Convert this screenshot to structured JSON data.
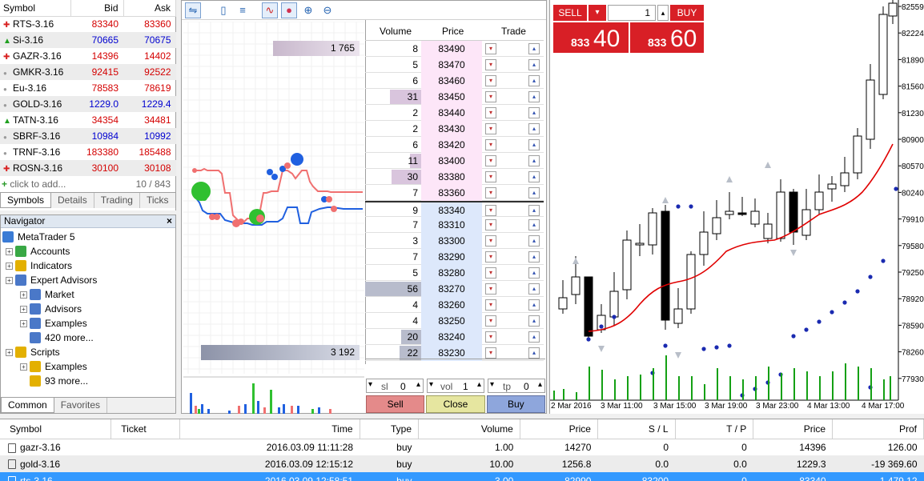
{
  "market_watch": {
    "headers": {
      "symbol": "Symbol",
      "bid": "Bid",
      "ask": "Ask"
    },
    "rows": [
      {
        "symbol": "RTS-3.16",
        "bid": "83340",
        "ask": "83360",
        "dir": "up"
      },
      {
        "symbol": "Si-3.16",
        "bid": "70665",
        "ask": "70675",
        "dir": "upg"
      },
      {
        "symbol": "GAZR-3.16",
        "bid": "14396",
        "ask": "14402",
        "dir": "up"
      },
      {
        "symbol": "GMKR-3.16",
        "bid": "92415",
        "ask": "92522",
        "dir": "none"
      },
      {
        "symbol": "Eu-3.16",
        "bid": "78583",
        "ask": "78619",
        "dir": "none"
      },
      {
        "symbol": "GOLD-3.16",
        "bid": "1229.0",
        "ask": "1229.4",
        "dir": "none"
      },
      {
        "symbol": "TATN-3.16",
        "bid": "34354",
        "ask": "34481",
        "dir": "upg"
      },
      {
        "symbol": "SBRF-3.16",
        "bid": "10984",
        "ask": "10992",
        "dir": "none"
      },
      {
        "symbol": "TRNF-3.16",
        "bid": "183380",
        "ask": "185488",
        "dir": "none"
      },
      {
        "symbol": "ROSN-3.16",
        "bid": "30100",
        "ask": "30108",
        "dir": "up"
      }
    ],
    "add_label": "click to add...",
    "count": "10 / 843",
    "tabs": [
      "Symbols",
      "Details",
      "Trading",
      "Ticks"
    ]
  },
  "navigator": {
    "title": "Navigator",
    "close": "×",
    "items": [
      {
        "label": "MetaTrader 5",
        "color": "#3a7bd5"
      },
      {
        "label": "Accounts",
        "color": "#39a845"
      },
      {
        "label": "Indicators",
        "color": "#e3b000"
      },
      {
        "label": "Expert Advisors",
        "color": "#4a78c8"
      },
      {
        "label": "Market",
        "color": "#4a78c8"
      },
      {
        "label": "Advisors",
        "color": "#4a78c8"
      },
      {
        "label": "Examples",
        "color": "#4a78c8"
      },
      {
        "label": "420 more...",
        "color": "#4a78c8"
      },
      {
        "label": "Scripts",
        "color": "#e3b000"
      },
      {
        "label": "Examples",
        "color": "#e3b000"
      },
      {
        "label": "93 more...",
        "color": "#e3b000"
      }
    ],
    "tabs": [
      "Common",
      "Favorites"
    ]
  },
  "dom": {
    "headers": {
      "volume": "Volume",
      "price": "Price",
      "trade": "Trade"
    },
    "ask_bar": "1 765",
    "bid_bar": "3 192",
    "rows": [
      {
        "volume": "8",
        "price": "83490",
        "side": "ask",
        "fill": 0
      },
      {
        "volume": "5",
        "price": "83470",
        "side": "ask",
        "fill": 0
      },
      {
        "volume": "6",
        "price": "83460",
        "side": "ask",
        "fill": 0
      },
      {
        "volume": "31",
        "price": "83450",
        "side": "ask",
        "fill": 0.55
      },
      {
        "volume": "2",
        "price": "83440",
        "side": "ask",
        "fill": 0
      },
      {
        "volume": "2",
        "price": "83430",
        "side": "ask",
        "fill": 0
      },
      {
        "volume": "6",
        "price": "83420",
        "side": "ask",
        "fill": 0
      },
      {
        "volume": "11",
        "price": "83400",
        "side": "ask",
        "fill": 0.2
      },
      {
        "volume": "30",
        "price": "83380",
        "side": "ask",
        "fill": 0.53
      },
      {
        "volume": "7",
        "price": "83360",
        "side": "ask",
        "fill": 0
      },
      {
        "volume": "9",
        "price": "83340",
        "side": "bid",
        "fill": 0
      },
      {
        "volume": "7",
        "price": "83310",
        "side": "bid",
        "fill": 0
      },
      {
        "volume": "3",
        "price": "83300",
        "side": "bid",
        "fill": 0
      },
      {
        "volume": "7",
        "price": "83290",
        "side": "bid",
        "fill": 0
      },
      {
        "volume": "5",
        "price": "83280",
        "side": "bid",
        "fill": 0
      },
      {
        "volume": "56",
        "price": "83270",
        "side": "bid",
        "fill": 1
      },
      {
        "volume": "4",
        "price": "83260",
        "side": "bid",
        "fill": 0
      },
      {
        "volume": "4",
        "price": "83250",
        "side": "bid",
        "fill": 0
      },
      {
        "volume": "20",
        "price": "83240",
        "side": "bid",
        "fill": 0.36
      },
      {
        "volume": "22",
        "price": "83230",
        "side": "bid",
        "fill": 0.39
      }
    ],
    "sl_label": "sl",
    "sl_value": "0",
    "vol_label": "vol",
    "vol_value": "1",
    "tp_label": "tp",
    "tp_value": "0",
    "sell": "Sell",
    "close": "Close",
    "buy": "Buy"
  },
  "one_click": {
    "sell": "SELL",
    "buy": "BUY",
    "lot": "1",
    "sell_small": "833",
    "sell_big": "40",
    "buy_small": "833",
    "buy_big": "60"
  },
  "chart": {
    "price_labels": [
      "82559",
      "82224",
      "81890",
      "81560",
      "81230",
      "80900",
      "80570",
      "80240",
      "79910",
      "79580",
      "79250",
      "78920",
      "78590",
      "78260",
      "77930"
    ],
    "time_labels": [
      "2 Mar 2016",
      "3 Mar 11:00",
      "3 Mar 15:00",
      "3 Mar 19:00",
      "3 Mar 23:00",
      "4 Mar 13:00",
      "4 Mar 17:00"
    ]
  },
  "trade": {
    "headers": [
      "Symbol",
      "Ticket",
      "Time",
      "Type",
      "Volume",
      "Price",
      "S / L",
      "T / P",
      "Price",
      "Prof"
    ],
    "rows": [
      [
        "gazr-3.16",
        "",
        "2016.03.09 11:11:28",
        "buy",
        "1.00",
        "14270",
        "0",
        "0",
        "14396",
        "126.00"
      ],
      [
        "gold-3.16",
        "",
        "2016.03.09 12:15:12",
        "buy",
        "10.00",
        "1256.8",
        "0.0",
        "0.0",
        "1229.3",
        "-19 369.60"
      ],
      [
        "rts-3.16",
        "",
        "2016.03.09 12:58:51",
        "buy",
        "3.00",
        "82990",
        "83200",
        "0",
        "83340",
        "1 479.12"
      ]
    ]
  },
  "colors": {
    "sell_btn": "#d81f26",
    "buy_btn": "#d81f26",
    "bid_text": "#d40000",
    "ask_text": "#0000d0",
    "ask_row": "#fde6f8",
    "bid_row": "#dde8fb"
  }
}
